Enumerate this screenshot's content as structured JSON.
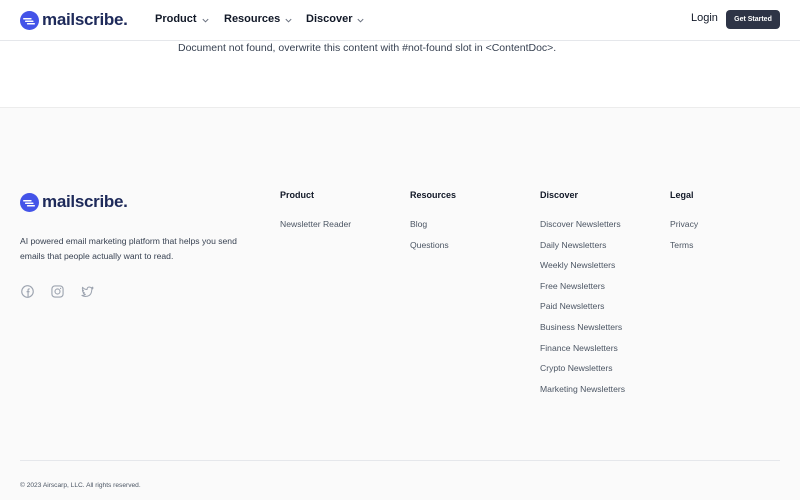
{
  "brand": {
    "name": "mailscribe.",
    "accent": "#4353e8"
  },
  "header": {
    "nav": [
      {
        "label": "Product"
      },
      {
        "label": "Resources"
      },
      {
        "label": "Discover"
      }
    ],
    "login_label": "Login",
    "cta_label": "Get Started"
  },
  "main": {
    "message": "Document not found, overwrite this content with #not-found slot in <ContentDoc>."
  },
  "footer": {
    "tagline": "AI powered email marketing platform that helps you send emails that people actually want to read.",
    "socials": [
      "facebook-icon",
      "instagram-icon",
      "twitter-icon"
    ],
    "columns": [
      {
        "title": "Product",
        "links": [
          "Newsletter Reader"
        ]
      },
      {
        "title": "Resources",
        "links": [
          "Blog",
          "Questions"
        ]
      },
      {
        "title": "Discover",
        "links": [
          "Discover Newsletters",
          "Daily Newsletters",
          "Weekly Newsletters",
          "Free Newsletters",
          "Paid Newsletters",
          "Business Newsletters",
          "Finance Newsletters",
          "Crypto Newsletters",
          "Marketing Newsletters"
        ]
      },
      {
        "title": "Legal",
        "links": [
          "Privacy",
          "Terms"
        ]
      }
    ],
    "copyright": "© 2023 Airscarp, LLC. All rights reserved."
  }
}
